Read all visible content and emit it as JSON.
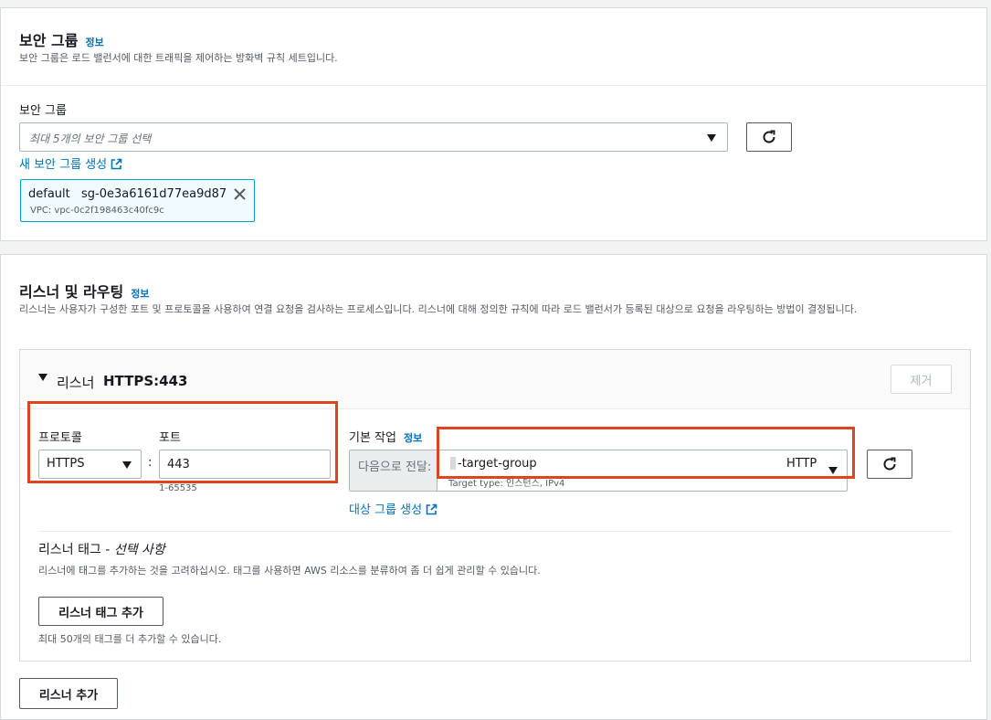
{
  "security_group": {
    "title": "보안 그룹",
    "info": "정보",
    "description": "보안 그룹은 로드 밸런서에 대한 트래픽을 제어하는 방화벽 규칙 세트입니다.",
    "field_label": "보안 그룹",
    "placeholder": "최대 5개의 보안 그룹 선택",
    "create_link": "새 보안 그룹 생성",
    "token": {
      "name": "default",
      "id": "sg-0e3a6161d77ea9d87",
      "vpc": "VPC: vpc-0c2f198463c40fc9c"
    }
  },
  "listeners": {
    "title": "리스너 및 라우팅",
    "info": "정보",
    "description": "리스너는 사용자가 구성한 포트 및 프로토콜을 사용하여 연결 요청을 검사하는 프로세스입니다. 리스너에 대해 정의한 규칙에 따라 로드 밸런서가 등록된 대상으로 요청을 라우팅하는 방법이 결정됩니다.",
    "listener": {
      "label": "리스너",
      "name": "HTTPS:443",
      "remove_label": "제거",
      "protocol_label": "프로토콜",
      "protocol_value": "HTTPS",
      "port_label": "포트",
      "port_value": "443",
      "port_hint": "1-65535",
      "colon": ":",
      "default_action_label": "기본 작업",
      "default_action_info": "정보",
      "forward_to_label": "다음으로 전달:",
      "target_group_name": "-target-group",
      "target_group_protocol": "HTTP",
      "target_group_meta": "Target type: 인스턴스, IPv4",
      "create_target_group_link": "대상 그룹 생성",
      "tags_title": "리스너 태그 - ",
      "tags_optional": "선택 사항",
      "tags_description": "리스너에 태그를 추가하는 것을 고려하십시오. 태그를 사용하면 AWS 리소스를 분류하여 좀 더 쉽게 관리할 수 있습니다.",
      "add_tag_button": "리스너 태그 추가",
      "tag_limit_note": "최대 50개의 태그를 더 추가할 수 있습니다."
    },
    "add_listener_button": "리스너 추가"
  },
  "colors": {
    "link": "#0073bb",
    "highlight": "#e1431c",
    "token_bg": "#f1faff",
    "token_border": "#00a1c9"
  }
}
